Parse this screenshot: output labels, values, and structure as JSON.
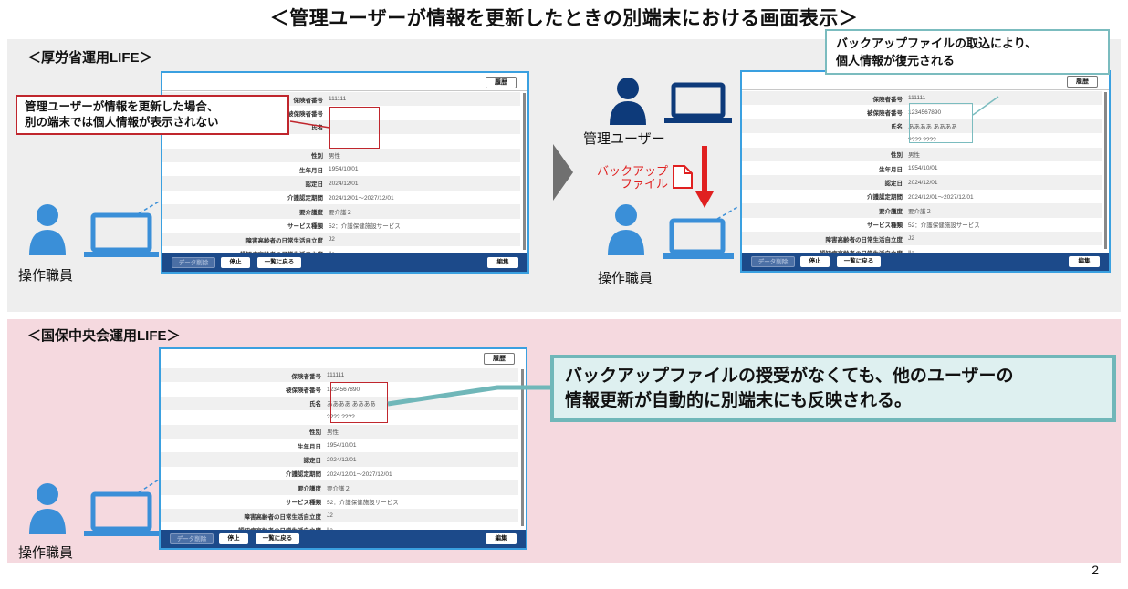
{
  "title": "＜管理ユーザーが情報を更新したときの別端末における画面表示＞",
  "section_mhlw": {
    "label": "＜厚労省運用LIFE＞"
  },
  "section_kokuho": {
    "label": "＜国保中央会運用LIFE＞"
  },
  "app_window": {
    "history_button": "履歴",
    "fields": [
      {
        "label": "保険者番号",
        "value": "111111"
      },
      {
        "label": "被保険者番号",
        "value": "1234567890"
      },
      {
        "label": "氏名",
        "value": "ああああ ああああ"
      },
      {
        "label": "",
        "value": "???? ????"
      },
      {
        "label": "性別",
        "value": "男性"
      },
      {
        "label": "生年月日",
        "value": "1954/10/01"
      },
      {
        "label": "認定日",
        "value": "2024/12/01"
      },
      {
        "label": "介護認定期間",
        "value": "2024/12/01～2027/12/01"
      },
      {
        "label": "要介護度",
        "value": "要介護２"
      },
      {
        "label": "サービス種類",
        "value": "52：介護保健施設サービス"
      },
      {
        "label": "障害高齢者の日常生活自立度",
        "value": "J2"
      },
      {
        "label": "認知症高齢者の日常生活自立度",
        "value": "Ⅱa"
      }
    ],
    "footer_buttons": {
      "delete": "データ削除",
      "stop": "停止",
      "back": "一覧に戻る",
      "edit": "編集"
    }
  },
  "callouts": {
    "not_shown": [
      "管理ユーザーが情報を更新した場合、",
      "別の端末では個人情報が表示されない"
    ],
    "restored": [
      "バックアップファイルの取込により、",
      "個人情報が復元される"
    ],
    "auto_sync": [
      "バックアップファイルの授受がなくても、他のユーザーの",
      "情報更新が自動的に別端末にも反映される。"
    ]
  },
  "roles": {
    "operator": "操作職員",
    "admin": "管理ユーザー"
  },
  "backup_file": [
    "バックアップ",
    "ファイル"
  ],
  "page_number": "2",
  "colors": {
    "navy": "#0d3a7a",
    "person_blue": "#3a8fd8",
    "pink_band": "#f5d9df",
    "gray_band": "#eeeeee",
    "accent_red": "#e02020",
    "teal": "#70b7b9"
  }
}
